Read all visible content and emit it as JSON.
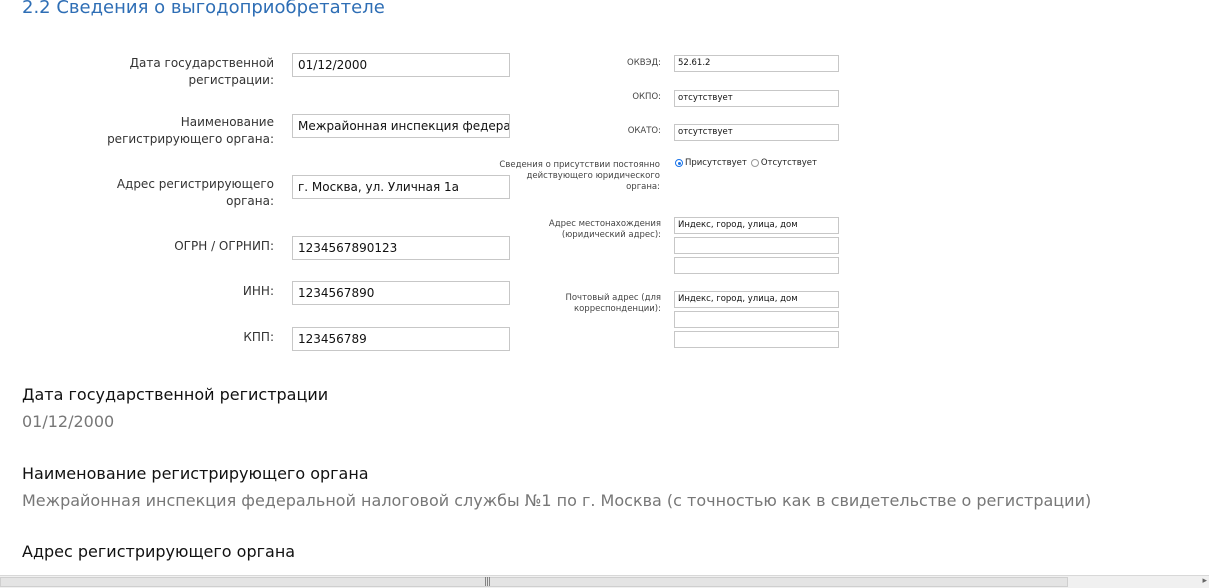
{
  "section_title": "2.2 Сведения о выгодоприобретателе",
  "left_form": {
    "reg_date": {
      "label": "Дата государственной регистрации:",
      "value": "01/12/2000"
    },
    "reg_body": {
      "label": "Наименование регистрирующего органа:",
      "value": "Межрайонная инспекция федеральн"
    },
    "reg_address": {
      "label": "Адрес регистрирующего органа:",
      "value": "г. Москва, ул. Уличная 1а"
    },
    "ogrn": {
      "label": "ОГРН / ОГРНИП:",
      "value": "1234567890123"
    },
    "inn": {
      "label": "ИНН:",
      "value": "1234567890"
    },
    "kpp": {
      "label": "КПП:",
      "value": "123456789"
    }
  },
  "right_form": {
    "okved": {
      "label": "ОКВЭД:",
      "value": "52.61.2"
    },
    "okpo": {
      "label": "ОКПО:",
      "value": "отсутствует"
    },
    "okato": {
      "label": "ОКАТО:",
      "value": "отсутствует"
    },
    "presence": {
      "label": "Сведения о присутствии постоянно действующего юридического органа:",
      "options": [
        "Присутствует",
        "Отсутствует"
      ],
      "selected": "Присутствует"
    },
    "legal_address": {
      "label": "Адрес местонахождения (юридический адрес):",
      "lines": [
        "Индекс, город, улица, дом",
        "",
        ""
      ]
    },
    "postal_address": {
      "label": "Почтовый адрес (для корреспонденции):",
      "lines": [
        "Индекс, город, улица, дом",
        "",
        ""
      ]
    }
  },
  "info": [
    {
      "label": "Дата государственной регистрации",
      "value": "01/12/2000"
    },
    {
      "label": "Наименование регистрирующего органа",
      "value": "Межрайонная инспекция федеральной налоговой службы №1 по г. Москва (с точностью как в свидетельстве о регистрации)"
    },
    {
      "label": "Адрес регистрирующего органа",
      "value": ""
    }
  ],
  "colors": {
    "title": "#2e6eb5",
    "radio_selected": "#1a73e8"
  }
}
